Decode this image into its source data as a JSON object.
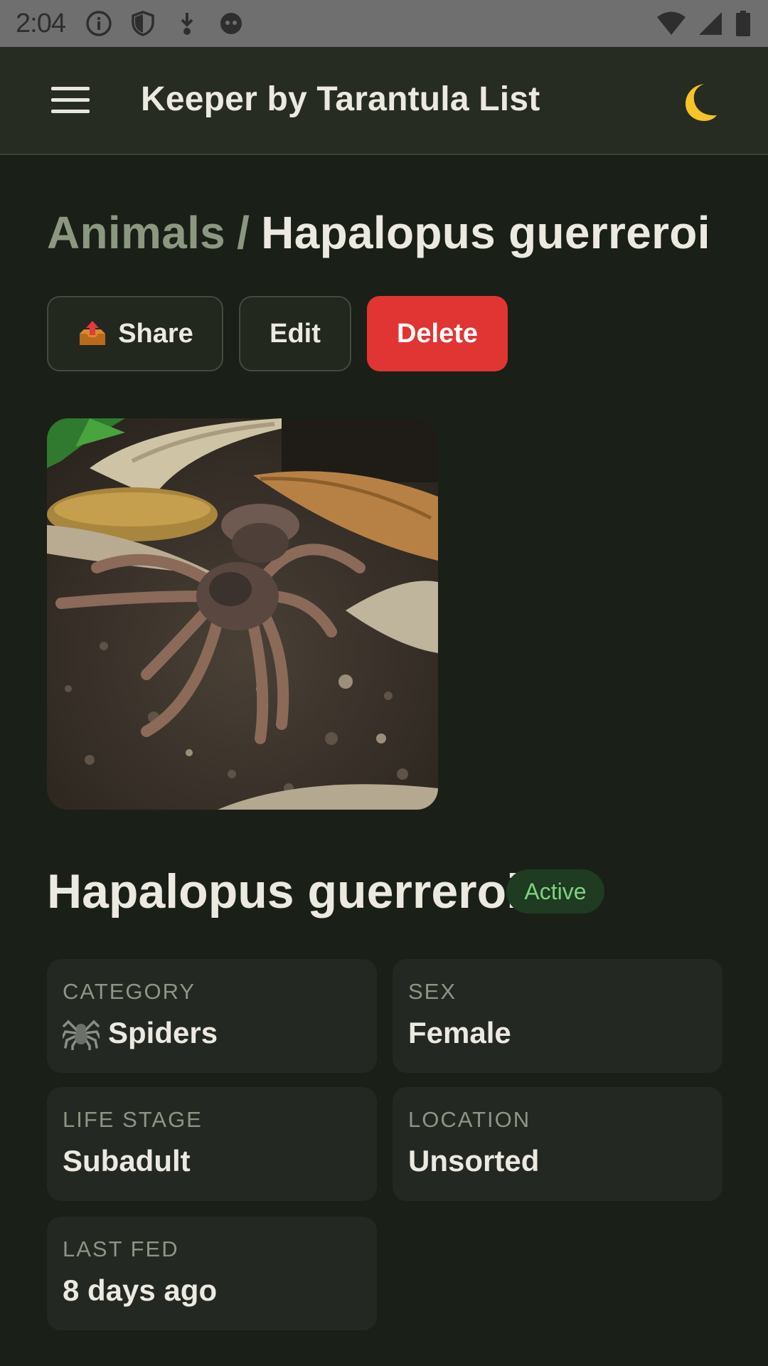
{
  "status_bar": {
    "time": "2:04",
    "icons_left": [
      "info-icon",
      "shield-icon",
      "download-icon",
      "face-icon"
    ],
    "icons_right": [
      "wifi-icon",
      "signal-icon",
      "battery-icon"
    ]
  },
  "app_bar": {
    "title": "Keeper by Tarantula List",
    "menu_icon": "hamburger-icon",
    "theme_icon": "moon-icon"
  },
  "breadcrumb": {
    "parent": "Animals",
    "separator": "/",
    "current": "Hapalopus guerreroi"
  },
  "actions": {
    "share_label": "Share",
    "share_icon": "📤",
    "edit_label": "Edit",
    "delete_label": "Delete"
  },
  "animal": {
    "name": "Hapalopus guerreroi",
    "status": "Active"
  },
  "details": {
    "category": {
      "label": "CATEGORY",
      "icon": "🕷️",
      "value": "Spiders"
    },
    "sex": {
      "label": "SEX",
      "value": "Female"
    },
    "life_stage": {
      "label": "LIFE STAGE",
      "value": "Subadult"
    },
    "location": {
      "label": "LOCATION",
      "value": "Unsorted"
    },
    "last_fed": {
      "label": "LAST FED",
      "value": "8 days ago"
    }
  },
  "colors": {
    "background": "#1a1f17",
    "app_bar": "#272c23",
    "delete": "#e03533",
    "badge_bg": "#1f3b21",
    "badge_text": "#7fd27f"
  }
}
